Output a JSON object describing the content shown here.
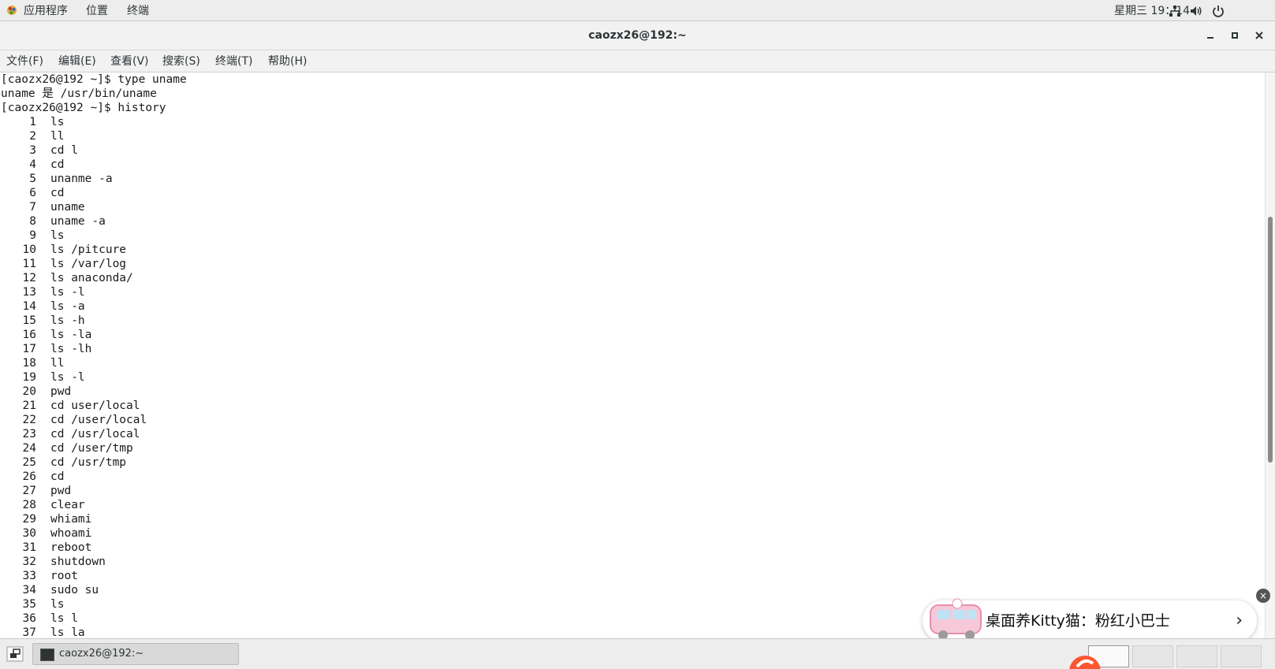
{
  "top_panel": {
    "applications_label": "应用程序",
    "places_label": "位置",
    "terminal_label": "终端",
    "clock": "星期三 19：14"
  },
  "window": {
    "title": "caozx26@192:~"
  },
  "menubar": {
    "items": [
      "文件(F)",
      "编辑(E)",
      "查看(V)",
      "搜索(S)",
      "终端(T)",
      "帮助(H)"
    ]
  },
  "terminal": {
    "lines": [
      "[caozx26@192 ~]$ type uname",
      "uname 是 /usr/bin/uname",
      "[caozx26@192 ~]$ history"
    ],
    "history": [
      {
        "num": "1",
        "cmd": "ls"
      },
      {
        "num": "2",
        "cmd": "ll"
      },
      {
        "num": "3",
        "cmd": "cd l"
      },
      {
        "num": "4",
        "cmd": "cd"
      },
      {
        "num": "5",
        "cmd": "unanme -a"
      },
      {
        "num": "6",
        "cmd": "cd"
      },
      {
        "num": "7",
        "cmd": "uname"
      },
      {
        "num": "8",
        "cmd": "uname -a"
      },
      {
        "num": "9",
        "cmd": "ls"
      },
      {
        "num": "10",
        "cmd": "ls /pitcure"
      },
      {
        "num": "11",
        "cmd": "ls /var/log"
      },
      {
        "num": "12",
        "cmd": "ls anaconda/"
      },
      {
        "num": "13",
        "cmd": "ls -l"
      },
      {
        "num": "14",
        "cmd": "ls -a"
      },
      {
        "num": "15",
        "cmd": "ls -h"
      },
      {
        "num": "16",
        "cmd": "ls -la"
      },
      {
        "num": "17",
        "cmd": "ls -lh"
      },
      {
        "num": "18",
        "cmd": "ll"
      },
      {
        "num": "19",
        "cmd": "ls -l"
      },
      {
        "num": "20",
        "cmd": "pwd"
      },
      {
        "num": "21",
        "cmd": "cd user/local"
      },
      {
        "num": "22",
        "cmd": "cd /user/local"
      },
      {
        "num": "23",
        "cmd": "cd /usr/local"
      },
      {
        "num": "24",
        "cmd": "cd /user/tmp"
      },
      {
        "num": "25",
        "cmd": "cd /usr/tmp"
      },
      {
        "num": "26",
        "cmd": "cd"
      },
      {
        "num": "27",
        "cmd": "pwd"
      },
      {
        "num": "28",
        "cmd": "clear"
      },
      {
        "num": "29",
        "cmd": "whiami"
      },
      {
        "num": "30",
        "cmd": "whoami"
      },
      {
        "num": "31",
        "cmd": "reboot"
      },
      {
        "num": "32",
        "cmd": "shutdown"
      },
      {
        "num": "33",
        "cmd": "root"
      },
      {
        "num": "34",
        "cmd": "sudo su"
      },
      {
        "num": "35",
        "cmd": "ls"
      },
      {
        "num": "36",
        "cmd": "ls l"
      },
      {
        "num": "37",
        "cmd": "ls la"
      }
    ]
  },
  "ad": {
    "text": "桌面养Kitty猫：粉红小巴士",
    "arrow": "›",
    "close": "×"
  },
  "taskbar": {
    "task_label": "caozx26@192:~"
  },
  "icons": {
    "apps": "gnome-foot-icon",
    "network": "network-icon",
    "volume": "volume-icon",
    "power": "power-icon"
  }
}
